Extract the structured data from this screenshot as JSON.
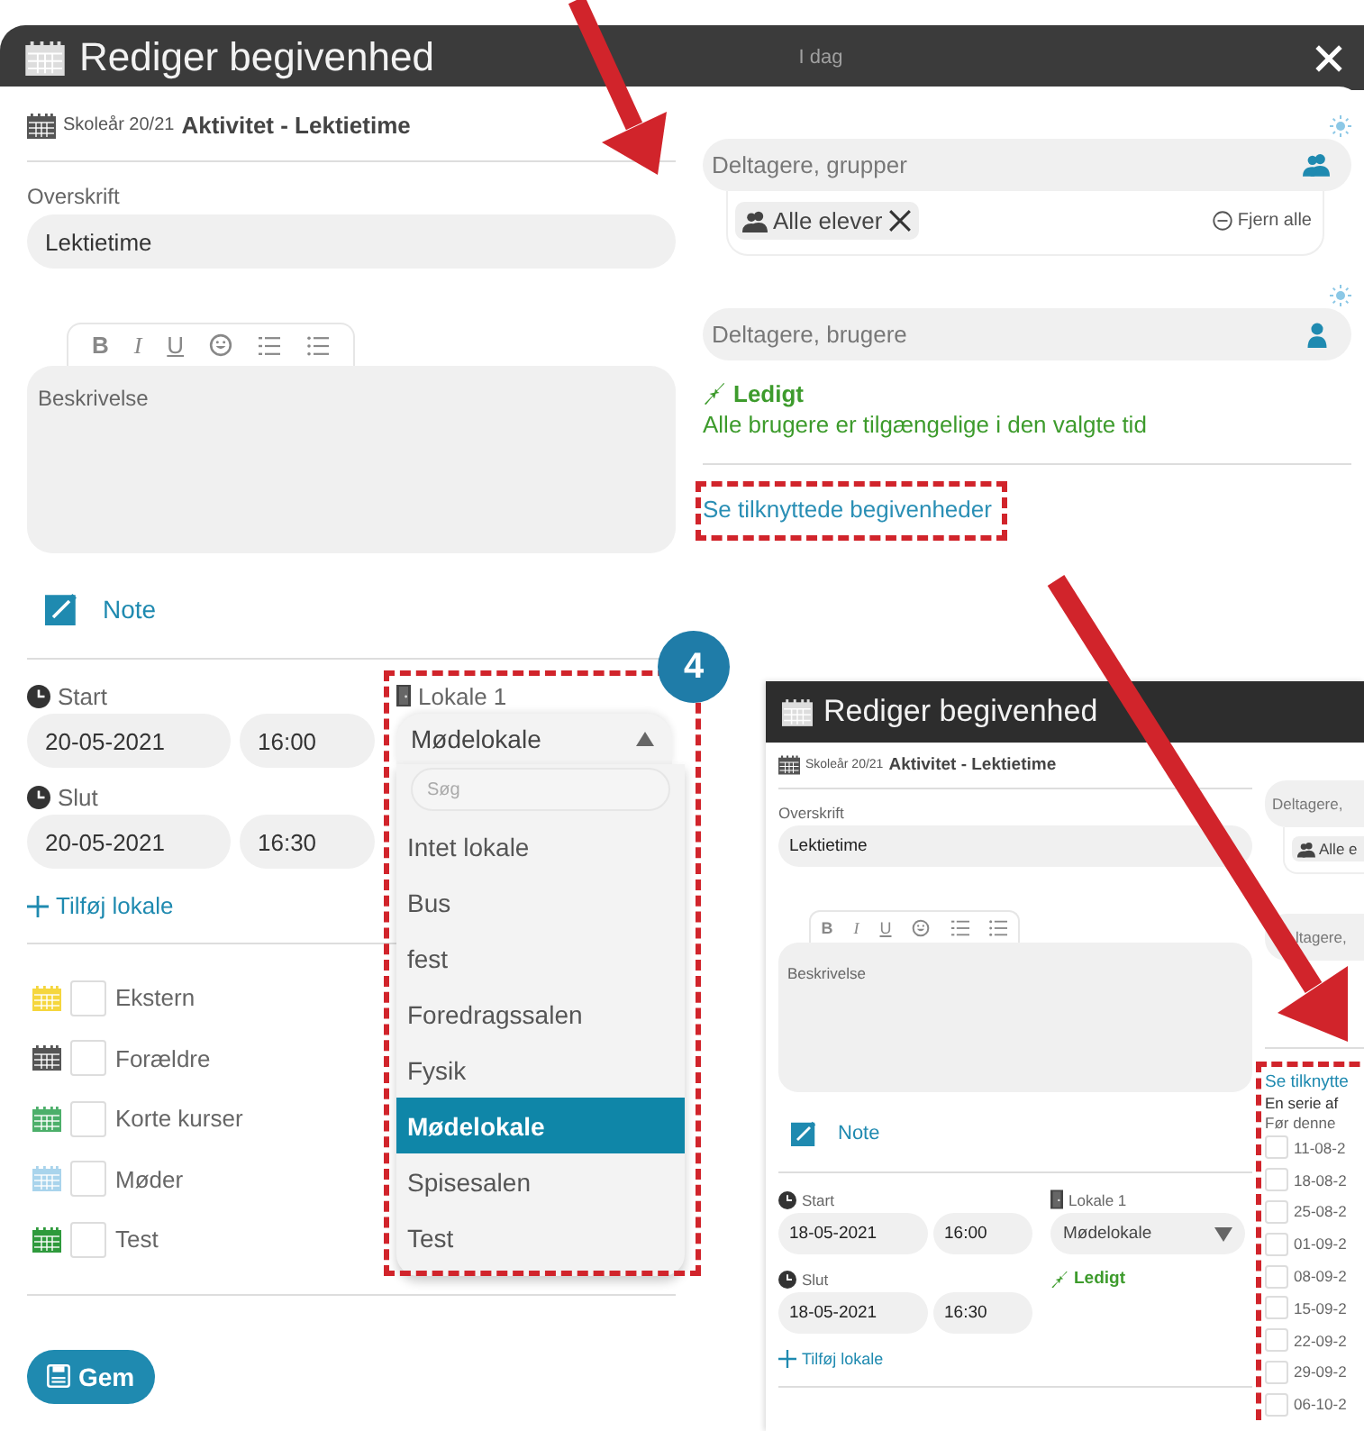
{
  "dialog": {
    "title": "Rediger begivenhed",
    "header_hint": "I dag"
  },
  "meta": {
    "school_year": "Skoleår 20/21",
    "activity": "Aktivitet - Lektietime"
  },
  "heading": {
    "label": "Overskrift",
    "value": "Lektietime"
  },
  "editor": {
    "toolbar": [
      {
        "kind": "bold",
        "label": "B"
      },
      {
        "kind": "italic",
        "label": "I"
      },
      {
        "kind": "underline",
        "label": "U"
      },
      {
        "kind": "emoji"
      },
      {
        "kind": "ordered_list"
      },
      {
        "kind": "bullet_list"
      }
    ],
    "placeholder": "Beskrivelse"
  },
  "note": {
    "label": "Note"
  },
  "start": {
    "label": "Start",
    "date": "20-05-2021",
    "time": "16:00"
  },
  "end": {
    "label": "Slut",
    "date": "20-05-2021",
    "time": "16:30"
  },
  "room": {
    "label": "Lokale 1",
    "value": "Mødelokale",
    "expanded": true,
    "search_placeholder": "Søg",
    "options": [
      {
        "label": "Intet lokale",
        "selected": false
      },
      {
        "label": "Bus",
        "selected": false
      },
      {
        "label": "fest",
        "selected": false
      },
      {
        "label": "Foredragssalen",
        "selected": false
      },
      {
        "label": "Fysik",
        "selected": false
      },
      {
        "label": "Mødelokale",
        "selected": true
      },
      {
        "label": "Spisesalen",
        "selected": false
      },
      {
        "label": "Test",
        "selected": false
      }
    ]
  },
  "add_room": "Tilføj lokale",
  "categories": [
    {
      "label": "Ekstern",
      "color": "#f5d63d",
      "checked": false
    },
    {
      "label": "Forældre",
      "color": "#555555",
      "checked": false
    },
    {
      "label": "Korte kurser",
      "color": "#4caf6a",
      "checked": false
    },
    {
      "label": "Møder",
      "color": "#a9d4ec",
      "checked": false
    },
    {
      "label": "Test",
      "color": "#2e9a3c",
      "checked": false
    }
  ],
  "save": "Gem",
  "participants_groups": {
    "placeholder": "Deltagere, grupper",
    "chips": [
      "Alle elever"
    ],
    "remove_all": "Fjern alle"
  },
  "participants_users": {
    "placeholder": "Deltagere, brugere"
  },
  "availability": {
    "status": "Ledigt",
    "message": "Alle brugere er tilgængelige i den valgte tid"
  },
  "related_link": "Se tilknyttede begivenheder",
  "step_badge": "4",
  "inset": {
    "title": "Rediger begivenhed",
    "meta": {
      "school_year": "Skoleår 20/21",
      "activity": "Aktivitet - Lektietime"
    },
    "heading": {
      "label": "Overskrift",
      "value": "Lektietime"
    },
    "editor": {
      "toolbar": [
        {
          "kind": "bold",
          "label": "B"
        },
        {
          "kind": "italic",
          "label": "I"
        },
        {
          "kind": "underline",
          "label": "U"
        },
        {
          "kind": "emoji"
        },
        {
          "kind": "ordered_list"
        },
        {
          "kind": "bullet_list"
        }
      ],
      "placeholder": "Beskrivelse"
    },
    "note": {
      "label": "Note"
    },
    "start": {
      "label": "Start",
      "date": "18-05-2021",
      "time": "16:00"
    },
    "end": {
      "label": "Slut",
      "date": "18-05-2021",
      "time": "16:30"
    },
    "room": {
      "label": "Lokale 1",
      "value": "Mødelokale",
      "expanded": false
    },
    "room_status": "Ledigt",
    "add_room": "Tilføj lokale",
    "participants": [
      {
        "placeholder": "Deltagere,"
      },
      {
        "placeholder": "ltagere,"
      }
    ],
    "chip": "Alle e",
    "related": {
      "link": "Se tilknytte",
      "series": "En serie af",
      "before": "Før denne",
      "dates": [
        {
          "label": "11-08-2",
          "checked": false
        },
        {
          "label": "18-08-2",
          "checked": false
        },
        {
          "label": "25-08-2",
          "checked": false
        },
        {
          "label": "01-09-2",
          "checked": false
        },
        {
          "label": "08-09-2",
          "checked": false
        },
        {
          "label": "15-09-2",
          "checked": false
        },
        {
          "label": "22-09-2",
          "checked": false
        },
        {
          "label": "29-09-2",
          "checked": false
        },
        {
          "label": "06-10-2",
          "checked": false
        }
      ]
    }
  }
}
